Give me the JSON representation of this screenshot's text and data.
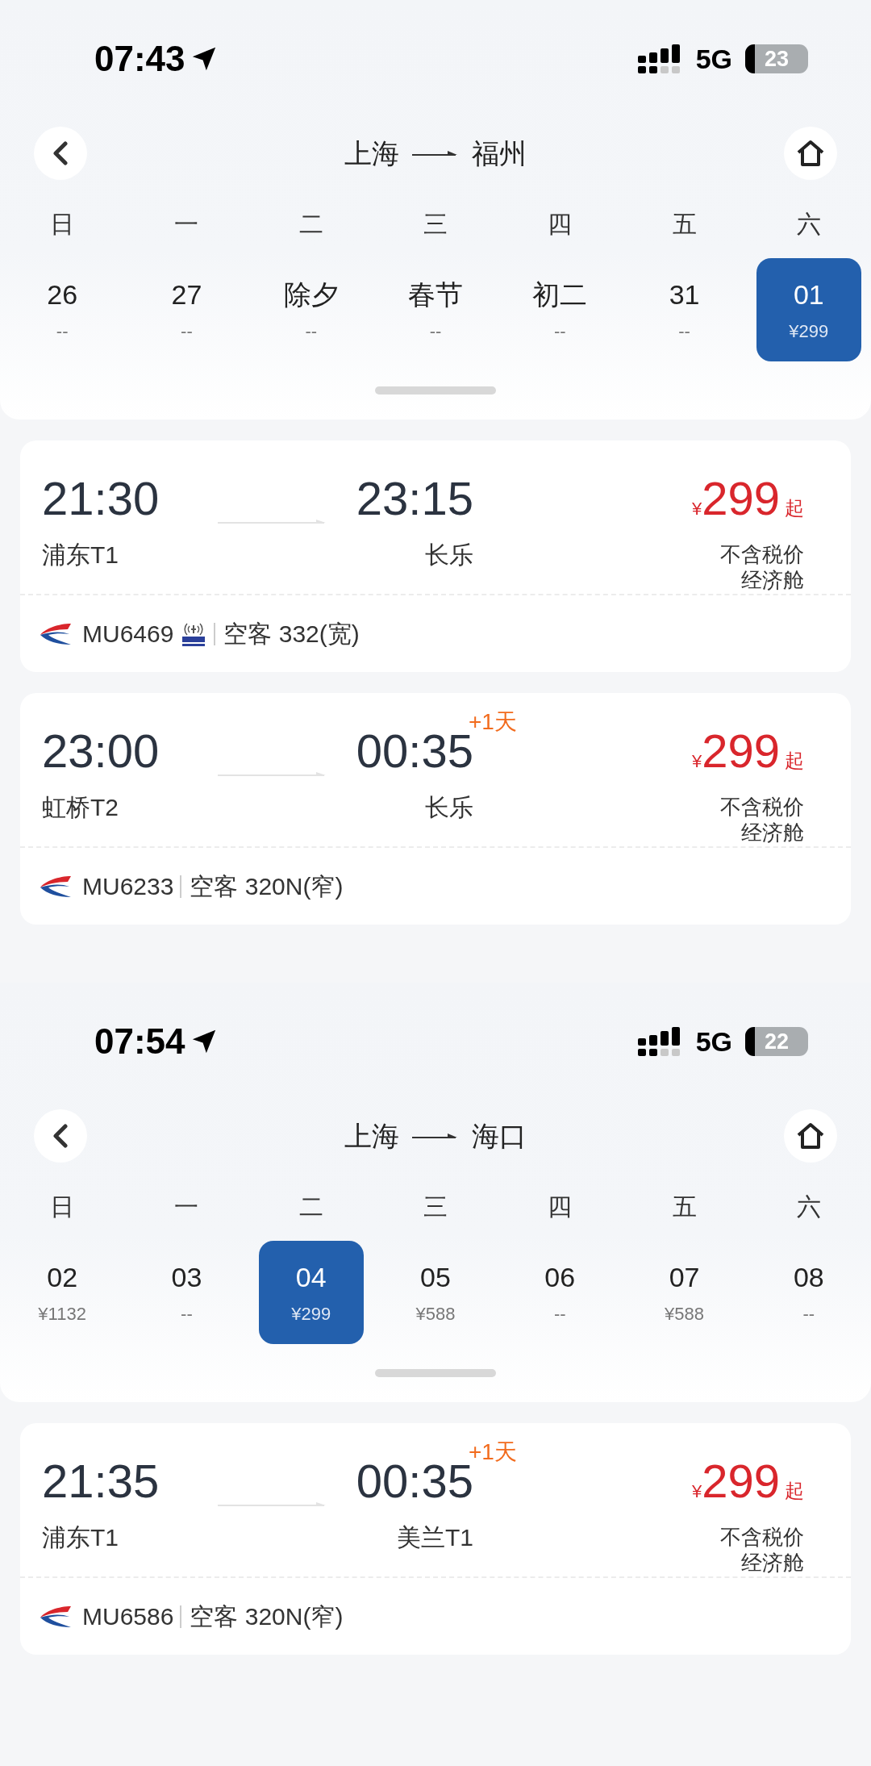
{
  "screens": [
    {
      "status": {
        "time": "07:43",
        "network": "5G",
        "battery": "23"
      },
      "route": {
        "from": "上海",
        "to": "福州"
      },
      "weekdays": [
        "日",
        "一",
        "二",
        "三",
        "四",
        "五",
        "六"
      ],
      "dates": [
        {
          "day": "26",
          "price": "--",
          "selected": false
        },
        {
          "day": "27",
          "price": "--",
          "selected": false
        },
        {
          "day": "除夕",
          "price": "--",
          "selected": false
        },
        {
          "day": "春节",
          "price": "--",
          "selected": false
        },
        {
          "day": "初二",
          "price": "--",
          "selected": false
        },
        {
          "day": "31",
          "price": "--",
          "selected": false
        },
        {
          "day": "01",
          "price": "¥299",
          "selected": true
        }
      ],
      "flights": [
        {
          "dep_time": "21:30",
          "dep_airport": "浦东T1",
          "arr_time": "23:15",
          "arr_airport": "长乐",
          "currency": "¥",
          "price": "299",
          "price_suffix": "起",
          "tax_note": "不含税价",
          "cabin": "经济舱",
          "flight_no": "MU6469",
          "wifi": true,
          "aircraft": "空客 332(宽)"
        },
        {
          "dep_time": "23:00",
          "dep_airport": "虹桥T2",
          "arr_time": "00:35",
          "next_day": "+1天",
          "arr_airport": "长乐",
          "currency": "¥",
          "price": "299",
          "price_suffix": "起",
          "tax_note": "不含税价",
          "cabin": "经济舱",
          "flight_no": "MU6233",
          "wifi": false,
          "aircraft": "空客 320N(窄)"
        }
      ]
    },
    {
      "status": {
        "time": "07:54",
        "network": "5G",
        "battery": "22"
      },
      "route": {
        "from": "上海",
        "to": "海口"
      },
      "weekdays": [
        "日",
        "一",
        "二",
        "三",
        "四",
        "五",
        "六"
      ],
      "dates": [
        {
          "day": "02",
          "price": "¥1132",
          "selected": false
        },
        {
          "day": "03",
          "price": "--",
          "selected": false
        },
        {
          "day": "04",
          "price": "¥299",
          "selected": true
        },
        {
          "day": "05",
          "price": "¥588",
          "selected": false
        },
        {
          "day": "06",
          "price": "--",
          "selected": false
        },
        {
          "day": "07",
          "price": "¥588",
          "selected": false
        },
        {
          "day": "08",
          "price": "--",
          "selected": false
        }
      ],
      "flights": [
        {
          "dep_time": "21:35",
          "dep_airport": "浦东T1",
          "arr_time": "00:35",
          "next_day": "+1天",
          "arr_airport": "美兰T1",
          "currency": "¥",
          "price": "299",
          "price_suffix": "起",
          "tax_note": "不含税价",
          "cabin": "经济舱",
          "flight_no": "MU6586",
          "wifi": false,
          "aircraft": "空客 320N(窄)"
        }
      ]
    }
  ]
}
